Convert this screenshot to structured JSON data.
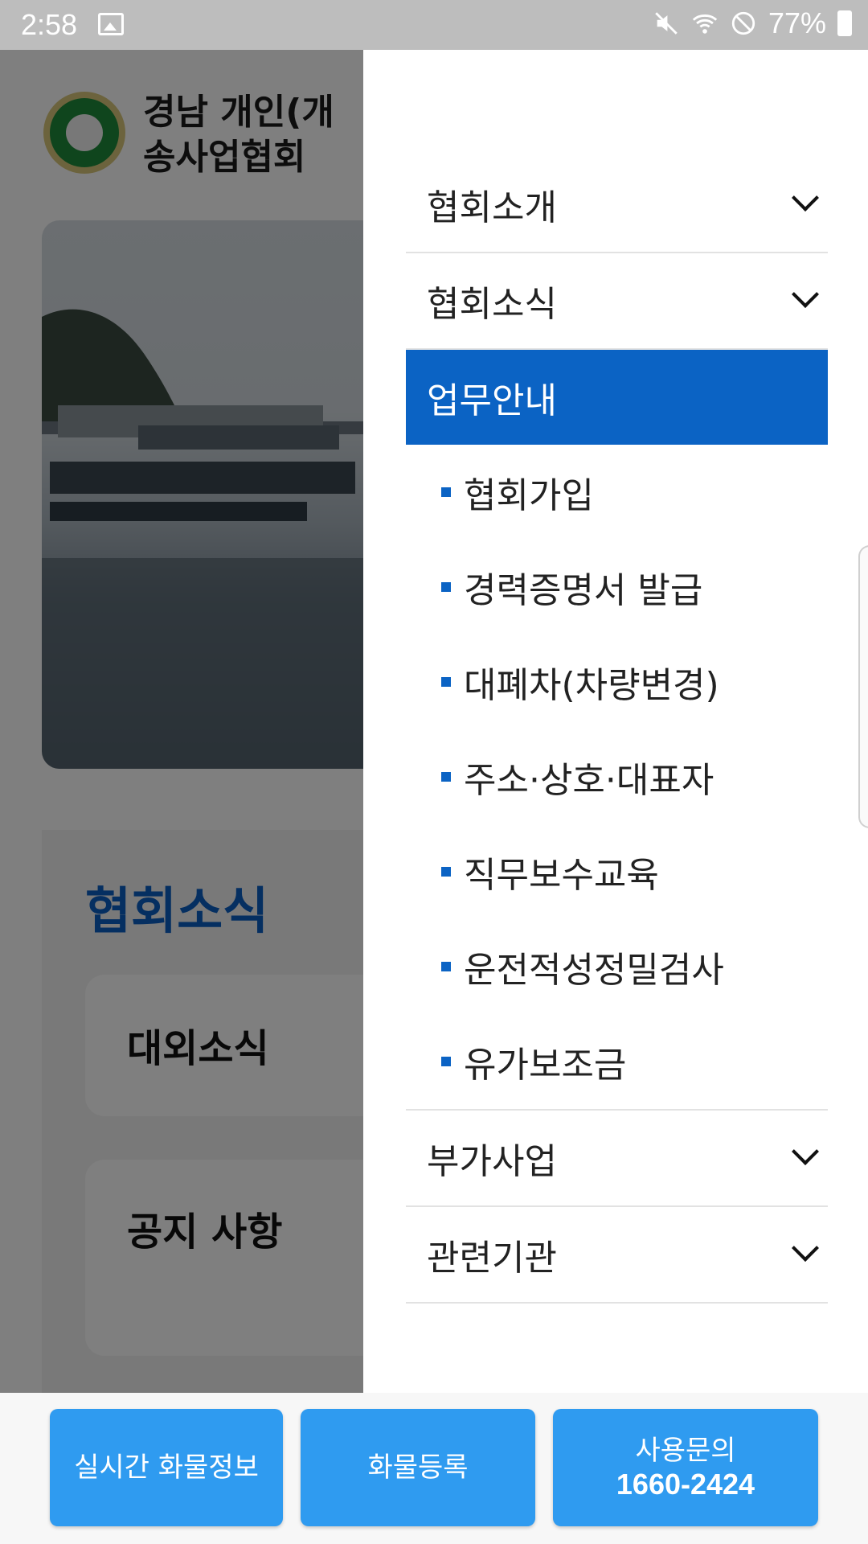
{
  "status_bar": {
    "time": "2:58",
    "battery": "77%",
    "icons": [
      "image-icon",
      "mute-icon",
      "wifi-icon",
      "dnd-icon",
      "battery-icon"
    ]
  },
  "background_page": {
    "site_title": "경남 개인(개\n송사업협회",
    "news_section_title": "협회소식",
    "news_cards": [
      {
        "label": "대외소식"
      },
      {
        "label": "공지 사항"
      }
    ]
  },
  "drawer": {
    "menu": [
      {
        "label": "협회소개",
        "expandable": true
      },
      {
        "label": "협회소식",
        "expandable": true
      },
      {
        "label": "업무안내",
        "active": true,
        "sub_items": [
          "협회가입",
          "경력증명서 발급",
          "대폐차(차량변경)",
          "주소·상호·대표자",
          "직무보수교육",
          "운전적성정밀검사",
          "유가보조금"
        ]
      },
      {
        "label": "부가사업",
        "expandable": true
      },
      {
        "label": "관련기관",
        "expandable": true
      }
    ]
  },
  "bottom_bar": {
    "realtime_label": "실시간 화물정보",
    "register_label": "화물등록",
    "inquiry_label": "사용문의",
    "inquiry_phone": "1660-2424"
  },
  "colors": {
    "accent": "#0b63c4",
    "button": "#2f9bf0",
    "news_title": "#0b5fc2"
  }
}
